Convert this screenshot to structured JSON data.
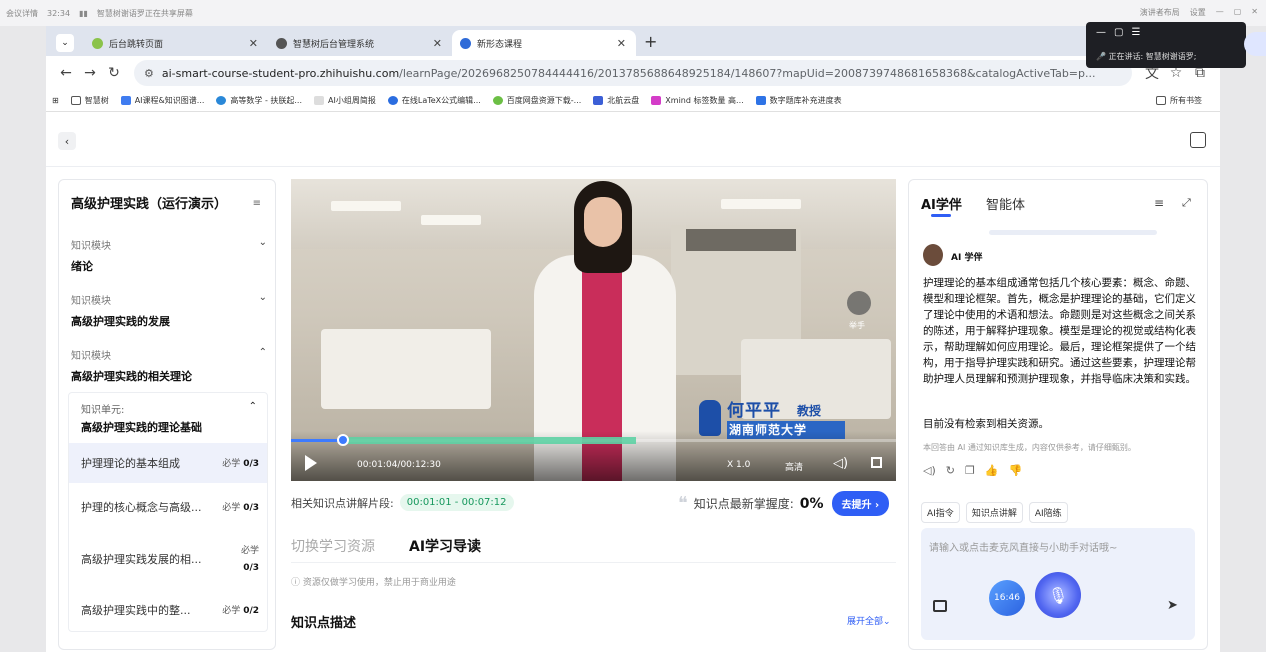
{
  "meeting_bar": {
    "items": [
      "会议详情",
      "32:34",
      "智慧树谢语罗正在共享屏幕"
    ],
    "right": [
      "演讲者布局",
      "设置"
    ]
  },
  "browser": {
    "tabs": [
      {
        "label": "后台跳转页面",
        "active": false
      },
      {
        "label": "智慧树后台管理系统",
        "active": false
      },
      {
        "label": "新形态课程",
        "active": true
      }
    ],
    "url_host": "ai-smart-course-student-pro.zhihuishu.com",
    "url_path": "/learnPage/2026968250784444416/2013785688648925184/148607?mapUid=2008739748681658368&catalogActiveTab=p...",
    "bookmarks": [
      "智慧树",
      "AI课程&知识图谱...",
      "高等数学 - 扶朕起...",
      "AI小组周简报",
      "在线LaTeX公式编辑...",
      "百度网盘资源下载-...",
      "北航云盘",
      "Xmind 标签数量 高...",
      "数字题库补充进度表"
    ],
    "all_bookmarks": "所有书签"
  },
  "overlay": {
    "speaking_label": "正在讲话:",
    "speaker": "智慧树谢语罗;"
  },
  "sidebar": {
    "title": "高级护理实践（运行演示）",
    "modules": [
      {
        "kind": "知识模块",
        "name": "绪论",
        "chev": "⌄"
      },
      {
        "kind": "知识模块",
        "name": "高级护理实践的发展",
        "chev": "⌄"
      },
      {
        "kind": "知识模块",
        "name": "高级护理实践的相关理论",
        "chev": "⌃"
      }
    ],
    "unit": {
      "kind": "知识单元:",
      "name": "高级护理实践的理论基础",
      "points": [
        {
          "name": "护理理论的基本组成",
          "req": "必学",
          "progress": "0/3"
        },
        {
          "name": "护理的核心概念与高级...",
          "req": "必学",
          "progress": "0/3"
        },
        {
          "name": "高级护理实践发展的相...",
          "req": "必学",
          "progress": "0/3"
        },
        {
          "name": "高级护理实践中的整...",
          "req": "必学",
          "progress": "0/2"
        }
      ]
    }
  },
  "video": {
    "speaker_name": "何平平",
    "speaker_title": "教授",
    "university": "湖南师范大学",
    "raise_hand": "举手",
    "time": "00:01:04/00:12:30",
    "speed": "X 1.0",
    "quality": "高清",
    "played_fraction": 0.0853,
    "segment_start_fraction": 0.0813,
    "segment_end_fraction": 0.5707
  },
  "related": {
    "label": "相关知识点讲解片段:",
    "range": "00:01:01 - 00:07:12"
  },
  "mastery": {
    "label": "知识点最新掌握度:",
    "value": "0%",
    "button": "去提升"
  },
  "content_tabs": [
    "切换学习资源",
    "AI学习导读"
  ],
  "notice": "资源仅做学习使用，禁止用于商业用途",
  "description_title": "知识点描述",
  "expand_all": "展开全部",
  "ai_panel": {
    "tab_active": "AI学伴",
    "tab_other": "智能体",
    "bot_name": "AI 学伴",
    "answer": "护理理论的基本组成通常包括几个核心要素：概念、命题、模型和理论框架。首先，概念是护理理论的基础，它们定义了理论中使用的术语和想法。命题则是对这些概念之间关系的陈述，用于解释护理现象。模型是理论的视觉或结构化表示，帮助理解如何应用理论。最后，理论框架提供了一个结构，用于指导护理实践和研究。通过这些要素，护理理论帮助护理人员理解和预测护理现象，并指导临床决策和实践。",
    "no_result": "目前没有检索到相关资源。",
    "disclaimer": "本回答由 AI 通过知识库生成，内容仅供参考，请仔细甄别。",
    "chips": [
      "AI指令",
      "知识点讲解",
      "AI陪练"
    ],
    "input_placeholder": "请输入或点击麦克风直接与小助手对话哦~",
    "timer": "16:46"
  }
}
